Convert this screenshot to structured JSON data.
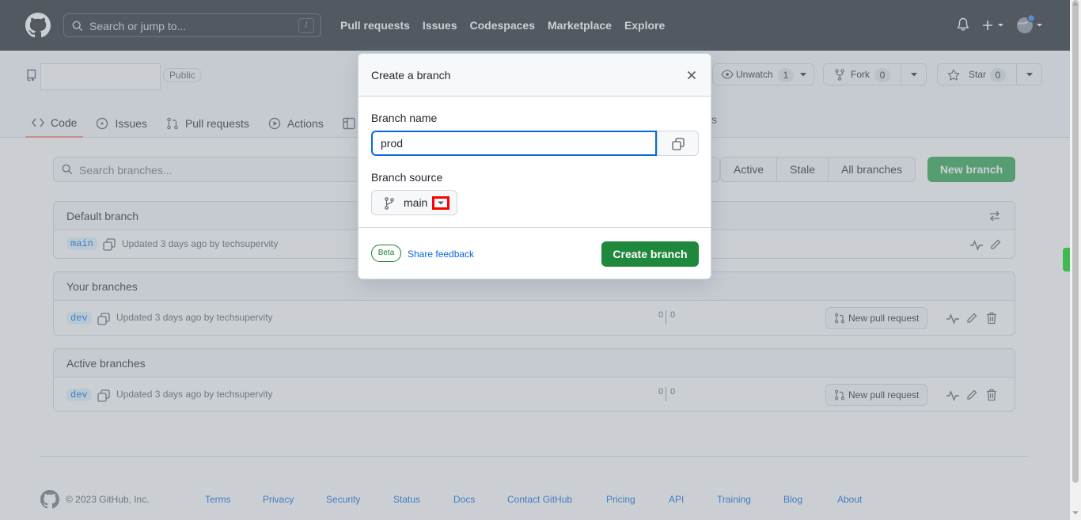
{
  "header": {
    "search_placeholder": "Search or jump to...",
    "search_key": "/",
    "nav": [
      "Pull requests",
      "Issues",
      "Codespaces",
      "Marketplace",
      "Explore"
    ]
  },
  "repo": {
    "visibility": "Public",
    "unwatch_label": "Unwatch",
    "unwatch_count": "1",
    "fork_label": "Fork",
    "fork_count": "0",
    "star_label": "Star",
    "star_count": "0",
    "tabs": [
      "Code",
      "Issues",
      "Pull requests",
      "Actions"
    ],
    "tab_fragment": "s"
  },
  "branches": {
    "search_placeholder": "Search branches...",
    "filters": [
      "Active",
      "Stale",
      "All branches"
    ],
    "new_branch_label": "New branch",
    "sections": [
      {
        "title": "Default branch",
        "rows": [
          {
            "name": "main",
            "updated": "Updated 3 days ago by techsupervity"
          }
        ]
      },
      {
        "title": "Your branches",
        "rows": [
          {
            "name": "dev",
            "updated": "Updated 3 days ago by techsupervity",
            "behind": "0",
            "ahead": "0",
            "pr_label": "New pull request"
          }
        ]
      },
      {
        "title": "Active branches",
        "rows": [
          {
            "name": "dev",
            "updated": "Updated 3 days ago by techsupervity",
            "behind": "0",
            "ahead": "0",
            "pr_label": "New pull request"
          }
        ]
      }
    ]
  },
  "footer": {
    "copyright": "© 2023 GitHub, Inc.",
    "links": [
      "Terms",
      "Privacy",
      "Security",
      "Status",
      "Docs",
      "Contact GitHub",
      "Pricing",
      "API",
      "Training",
      "Blog",
      "About"
    ]
  },
  "dialog": {
    "title": "Create a branch",
    "branch_name_label": "Branch name",
    "branch_name_value": "prod",
    "branch_source_label": "Branch source",
    "source_branch": "main",
    "beta_label": "Beta",
    "feedback_label": "Share feedback",
    "create_label": "Create branch"
  },
  "colors": {
    "header_bg": "#24292f",
    "primary_green": "#1f883d",
    "link_blue": "#0969da",
    "highlight_red": "#ff0000"
  }
}
